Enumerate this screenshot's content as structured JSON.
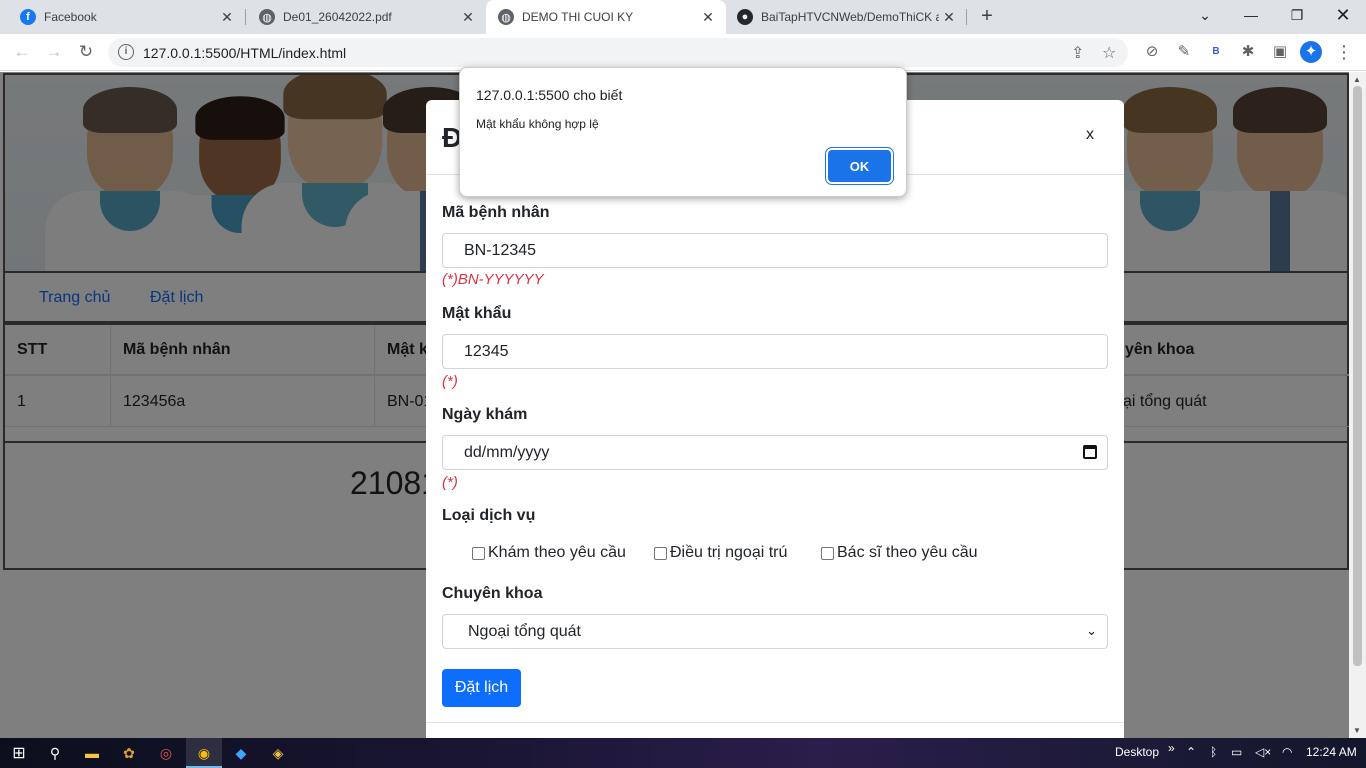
{
  "browser": {
    "tabs": [
      {
        "title": "Facebook",
        "icon": "facebook-icon",
        "color": "#1877f2"
      },
      {
        "title": "De01_26042022.pdf",
        "icon": "globe-icon",
        "color": "#5f6368"
      },
      {
        "title": "DEMO THI CUOI KY",
        "icon": "globe-icon",
        "color": "#5f6368"
      },
      {
        "title": "BaiTapHTVCNWeb/DemoThiCK a",
        "icon": "github-icon",
        "color": "#24292f"
      }
    ],
    "url": "127.0.0.1:5500/HTML/index.html"
  },
  "page": {
    "nav": [
      "Trang chủ",
      "Đặt lịch"
    ],
    "table": {
      "headers": [
        "STT",
        "Mã bệnh nhân",
        "Mật k",
        "yên khoa"
      ],
      "rows": [
        [
          "1",
          "123456a",
          "BN-01",
          "ại tổng quát"
        ]
      ]
    },
    "footer_code": "21081"
  },
  "modal": {
    "title": "Đ",
    "close": "x",
    "patient_id_label": "Mã bệnh nhân",
    "patient_id_value": "BN-12345",
    "patient_id_hint": "(*)BN-YYYYYY",
    "password_label": "Mật khẩu",
    "password_value": "12345",
    "password_hint": "(*)",
    "date_label": "Ngày khám",
    "date_placeholder": "dd/mm/yyyy",
    "date_hint": "(*)",
    "service_label": "Loại dịch vụ",
    "services": [
      "Khám theo yêu cầu",
      "Điều trị ngoại trú",
      "Bác sĩ theo yêu cầu"
    ],
    "specialty_label": "Chuyên khoa",
    "specialty_value": "Ngoại tổng quát",
    "submit": "Đặt lịch"
  },
  "alert": {
    "origin": "127.0.0.1:5500 cho biết",
    "message": "Mật khẩu không hợp lệ",
    "ok": "OK"
  },
  "taskbar": {
    "desktop": "Desktop",
    "time": "12:24 AM"
  },
  "colors": {
    "primary": "#0d6efd",
    "error": "#dc3545",
    "chrome_blue": "#1a73e8"
  }
}
